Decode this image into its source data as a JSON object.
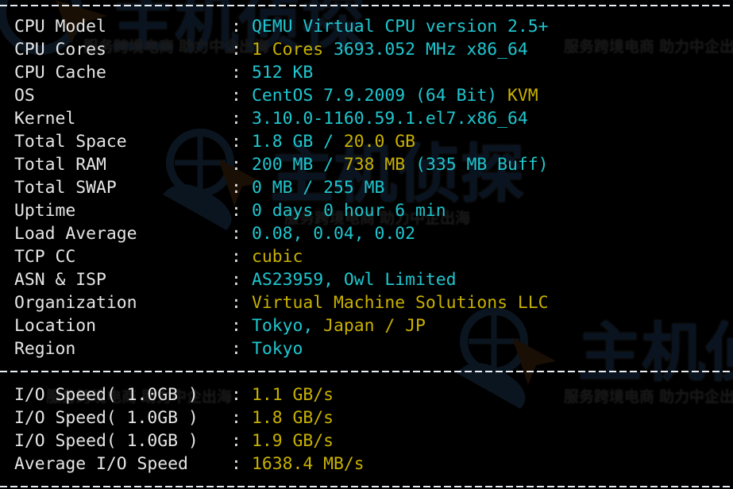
{
  "colors": {
    "background": "#000000",
    "label": "#e6e6e6",
    "cyan": "#1fc6cf",
    "yellow": "#c9b100",
    "divider": "#e8eef4"
  },
  "watermark": {
    "brand": "主机侦探",
    "slogan": "服务跨境电商 助力中企出海",
    "icon": "globe-cursor-logo-icon"
  },
  "separator_char": "-",
  "system_info": [
    {
      "label": "CPU Model",
      "segments": [
        {
          "text": "QEMU Virtual CPU version 2.5+",
          "color": "cyan"
        }
      ]
    },
    {
      "label": "CPU Cores",
      "segments": [
        {
          "text": "1 Cores",
          "color": "yellow"
        },
        {
          "text": " 3693.052 MHz x86_64",
          "color": "cyan"
        }
      ]
    },
    {
      "label": "CPU Cache",
      "segments": [
        {
          "text": "512 KB",
          "color": "cyan"
        }
      ]
    },
    {
      "label": "OS",
      "segments": [
        {
          "text": "CentOS 7.9.2009 (64 Bit)",
          "color": "cyan"
        },
        {
          "text": " KVM",
          "color": "yellow"
        }
      ]
    },
    {
      "label": "Kernel",
      "segments": [
        {
          "text": "3.10.0-1160.59.1.el7.x86_64",
          "color": "cyan"
        }
      ]
    },
    {
      "label": "Total Space",
      "segments": [
        {
          "text": "1.8 GB / ",
          "color": "cyan"
        },
        {
          "text": "20.0 GB",
          "color": "yellow"
        }
      ]
    },
    {
      "label": "Total RAM",
      "segments": [
        {
          "text": "200 MB / ",
          "color": "cyan"
        },
        {
          "text": "738 MB",
          "color": "yellow"
        },
        {
          "text": " (335 MB Buff)",
          "color": "cyan"
        }
      ]
    },
    {
      "label": "Total SWAP",
      "segments": [
        {
          "text": "0 MB / 255 MB",
          "color": "cyan"
        }
      ]
    },
    {
      "label": "Uptime",
      "segments": [
        {
          "text": "0 days 0 hour 6 min",
          "color": "cyan"
        }
      ]
    },
    {
      "label": "Load Average",
      "segments": [
        {
          "text": "0.08, 0.04, 0.02",
          "color": "cyan"
        }
      ]
    },
    {
      "label": "TCP CC",
      "segments": [
        {
          "text": "cubic",
          "color": "yellow"
        }
      ]
    },
    {
      "label": "ASN & ISP",
      "segments": [
        {
          "text": "AS23959, Owl Limited",
          "color": "cyan"
        }
      ]
    },
    {
      "label": "Organization",
      "segments": [
        {
          "text": "Virtual Machine Solutions LLC",
          "color": "yellow"
        }
      ]
    },
    {
      "label": "Location",
      "segments": [
        {
          "text": "Tokyo, ",
          "color": "cyan"
        },
        {
          "text": "Japan / JP",
          "color": "yellow"
        }
      ]
    },
    {
      "label": "Region",
      "segments": [
        {
          "text": "Tokyo",
          "color": "cyan"
        }
      ]
    }
  ],
  "io_info": [
    {
      "label": "I/O Speed( 1.0GB )",
      "segments": [
        {
          "text": "1.1 GB/s",
          "color": "yellow"
        }
      ]
    },
    {
      "label": "I/O Speed( 1.0GB )",
      "segments": [
        {
          "text": "1.8 GB/s",
          "color": "yellow"
        }
      ]
    },
    {
      "label": "I/O Speed( 1.0GB )",
      "segments": [
        {
          "text": "1.9 GB/s",
          "color": "yellow"
        }
      ]
    },
    {
      "label": "Average I/O Speed",
      "segments": [
        {
          "text": "1638.4 MB/s",
          "color": "yellow"
        }
      ]
    }
  ],
  "colon": ":"
}
